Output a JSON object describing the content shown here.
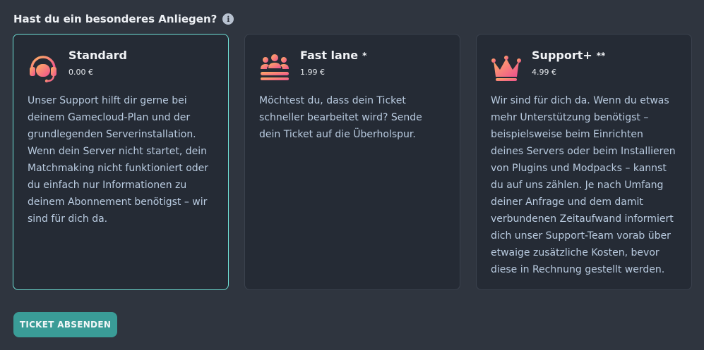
{
  "heading": {
    "text": "Hast du ein besonderes Anliegen?",
    "info_glyph": "i"
  },
  "cards": [
    {
      "title": "Standard",
      "star": "",
      "price": "0.00 €",
      "icon": "headset-icon",
      "selected": true,
      "description": "Unser Support hilft dir gerne bei deinem Gamecloud-Plan und der grundlegenden Serverinstallation. Wenn dein Server nicht startet, dein Matchmaking nicht funktioniert oder du einfach nur Informationen zu deinem Abonnement benötigst – wir sind für dich da."
    },
    {
      "title": "Fast lane",
      "star": "*",
      "price": "1.99 €",
      "icon": "group-icon",
      "selected": false,
      "description": "Möchtest du, dass dein Ticket schneller bearbeitet wird? Sende dein Ticket auf die Überholspur."
    },
    {
      "title": "Support+",
      "star": "**",
      "price": "4.99 €",
      "icon": "crown-icon",
      "selected": false,
      "description": "Wir sind für dich da. Wenn du etwas mehr Unterstützung benötigst – beispielsweise beim Einrichten deines Servers oder beim Installieren von Plugins und Modpacks – kannst du auf uns zählen. Je nach Umfang deiner Anfrage und dem damit verbundenen Zeitaufwand informiert dich unser Support-Team vorab über etwaige zusätzliche Kosten, bevor diese in Rechnung gestellt werden."
    }
  ],
  "submit_label": "TICKET ABSENDEN",
  "colors": {
    "accent": "#6fe0d6",
    "button": "#3a9c97",
    "icon_gradient_start": "#ff9e5e",
    "icon_gradient_end": "#f0508c"
  }
}
